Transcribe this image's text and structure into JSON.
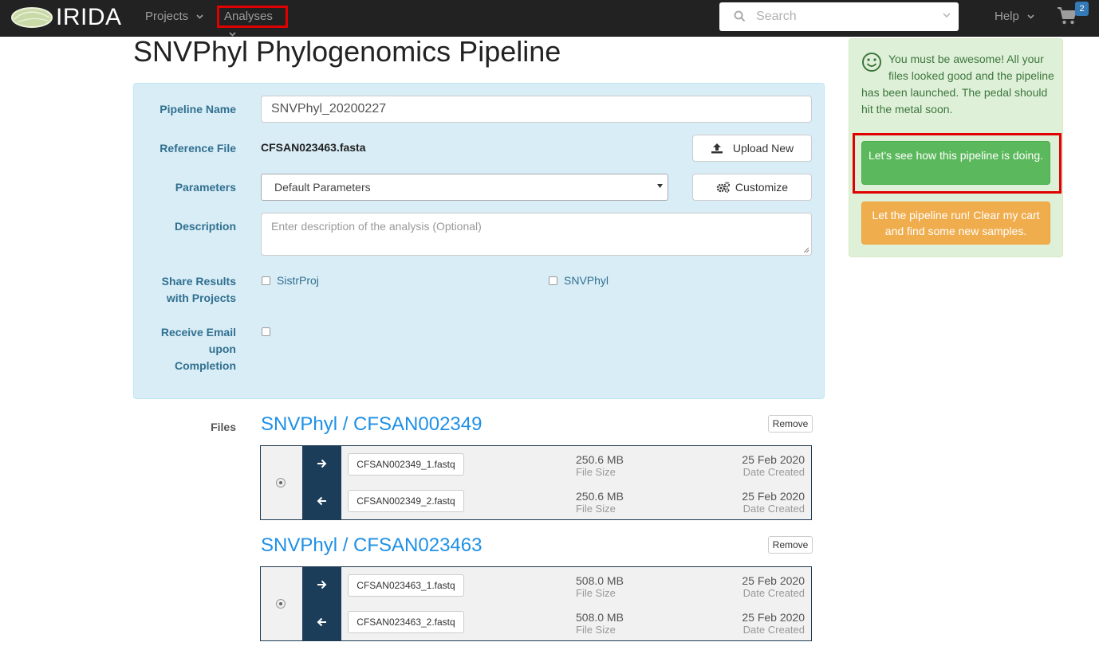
{
  "navbar": {
    "brand": "IRIDA",
    "projects_label": "Projects",
    "analyses_label": "Analyses",
    "search_placeholder": "Search",
    "help_label": "Help",
    "cart_count": "2"
  },
  "page": {
    "title": "SNVPhyl Phylogenomics Pipeline"
  },
  "form": {
    "pipeline_name_label": "Pipeline Name",
    "pipeline_name_value": "SNVPhyl_20200227",
    "reference_file_label": "Reference File",
    "reference_file_value": "CFSAN023463.fasta",
    "upload_button": "Upload New",
    "parameters_label": "Parameters",
    "parameters_value": "Default Parameters",
    "customize_button": "Customize",
    "description_label": "Description",
    "description_placeholder": "Enter description of the analysis (Optional)",
    "share_label_line1": "Share Results",
    "share_label_line2": "with Projects",
    "share_projects": [
      "SistrProj",
      "SNVPhyl"
    ],
    "email_label_line1": "Receive Email",
    "email_label_line2": "upon",
    "email_label_line3": "Completion"
  },
  "files": {
    "label": "Files",
    "remove_label": "Remove",
    "samples": [
      {
        "title": "SNVPhyl / CFSAN002349",
        "files": [
          {
            "name": "CFSAN002349_1.fastq",
            "size": "250.6 MB",
            "size_label": "File Size",
            "date": "25 Feb 2020",
            "date_label": "Date Created"
          },
          {
            "name": "CFSAN002349_2.fastq",
            "size": "250.6 MB",
            "size_label": "File Size",
            "date": "25 Feb 2020",
            "date_label": "Date Created"
          }
        ]
      },
      {
        "title": "SNVPhyl / CFSAN023463",
        "files": [
          {
            "name": "CFSAN023463_1.fastq",
            "size": "508.0 MB",
            "size_label": "File Size",
            "date": "25 Feb 2020",
            "date_label": "Date Created"
          },
          {
            "name": "CFSAN023463_2.fastq",
            "size": "508.0 MB",
            "size_label": "File Size",
            "date": "25 Feb 2020",
            "date_label": "Date Created"
          }
        ]
      }
    ]
  },
  "alert": {
    "message": "You must be awesome! All your files looked good and the pipeline has been launched. The pedal should hit the metal soon.",
    "primary_button": "Let's see how this pipeline is doing.",
    "secondary_button": "Let the pipeline run! Clear my cart and find some new samples."
  },
  "colors": {
    "navbar_bg": "#222222",
    "panel_bg": "#d9edf7",
    "label_color": "#31708f",
    "sample_title": "#1e90e6",
    "direction_bg": "#1c3d5a",
    "alert_bg": "#dff0d8",
    "success": "#5cb85c",
    "warning": "#f0ad4e",
    "highlight": "#e00000"
  },
  "icons": [
    "irida-logo-icon",
    "chevron-down-icon",
    "search-icon",
    "shopping-cart-icon",
    "upload-icon",
    "gears-icon",
    "arrow-right-icon",
    "arrow-left-icon",
    "smile-icon"
  ]
}
